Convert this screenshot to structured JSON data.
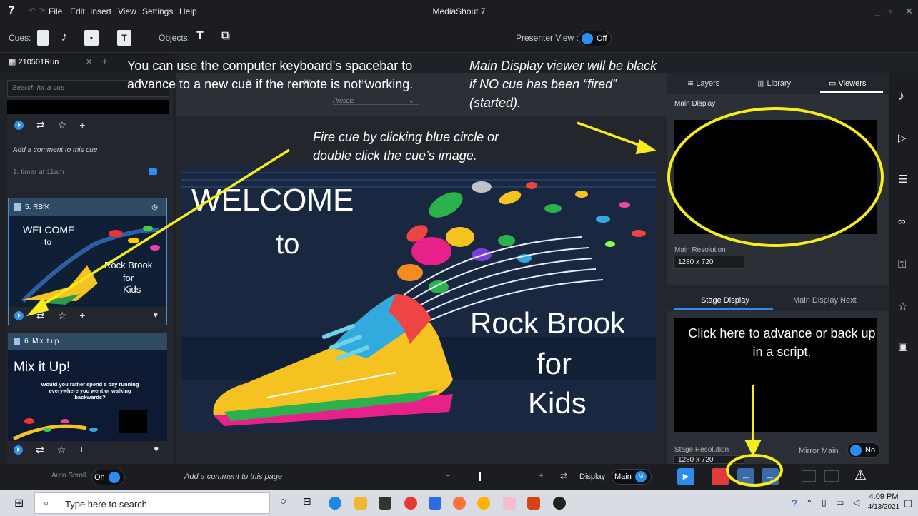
{
  "app": {
    "logo": "7",
    "title": "MediaShout 7",
    "menu": [
      "File",
      "Edit",
      "Insert",
      "View",
      "Settings",
      "Help"
    ]
  },
  "toolbar": {
    "cues_label": "Cues:",
    "objects_label": "Objects:",
    "presenter_view_label": "Presenter View :",
    "presenter_view_state": "Off"
  },
  "tabs": {
    "file_tab": "210501Run"
  },
  "cue_panel": {
    "search_placeholder": "Search for a cue",
    "comment_placeholder": "Add a comment to this cue",
    "timer_cue": "1. timer at 11am",
    "cue5": {
      "title": "5. RBfK",
      "thumb_lines": [
        "WELCOME",
        "to",
        "Rock Brook",
        "for",
        "Kids"
      ]
    },
    "cue6": {
      "title": "6. Mix it up",
      "thumb_title": "Mix it Up!",
      "thumb_body": "Would you rather spend a day running everywhere you went or walking backwards?"
    },
    "auto_scroll_label": "Auto Scroll",
    "auto_scroll_state": "On"
  },
  "editor": {
    "presets_label": "Presets",
    "coords": [
      "X:",
      "Y:",
      "W:",
      "H:"
    ],
    "slide_text": {
      "welcome": "WELCOME",
      "to": "to",
      "rock_brook": "Rock Brook",
      "for": "for",
      "kids": "Kids"
    },
    "page_comment_placeholder": "Add a comment to this page",
    "display_label": "Display",
    "display_value": "Main",
    "display_badge": "M"
  },
  "right_panel": {
    "tabs": [
      "Layers",
      "Library",
      "Viewers"
    ],
    "main_display_label": "Main Display",
    "main_resolution_label": "Main Resolution",
    "main_resolution_value": "1280 x 720",
    "stage_tabs": [
      "Stage Display",
      "Main Display Next"
    ],
    "stage_resolution_label": "Stage Resolution",
    "stage_resolution_value": "1280 x 720",
    "mirror_main_label": "Mirror Main",
    "mirror_main_state": "No"
  },
  "annotations": {
    "spacebar": "You can use the computer keyboard’s spacebar to advance to a new cue if the remote is not working.",
    "fire_cue": "Fire cue by clicking blue circle or double click the cue’s image.",
    "main_viewer": "Main Display viewer will be black if NO cue has been “fired” (started).",
    "advance": "Click here to advance or back up in a script."
  },
  "taskbar": {
    "search_placeholder": "Type here to search",
    "time": "4:09 PM",
    "date": "4/13/2021"
  },
  "colors": {
    "accent_blue": "#2d8cf0",
    "annotation_yellow": "#f7ec1c",
    "stop_red": "#e03a3a"
  }
}
